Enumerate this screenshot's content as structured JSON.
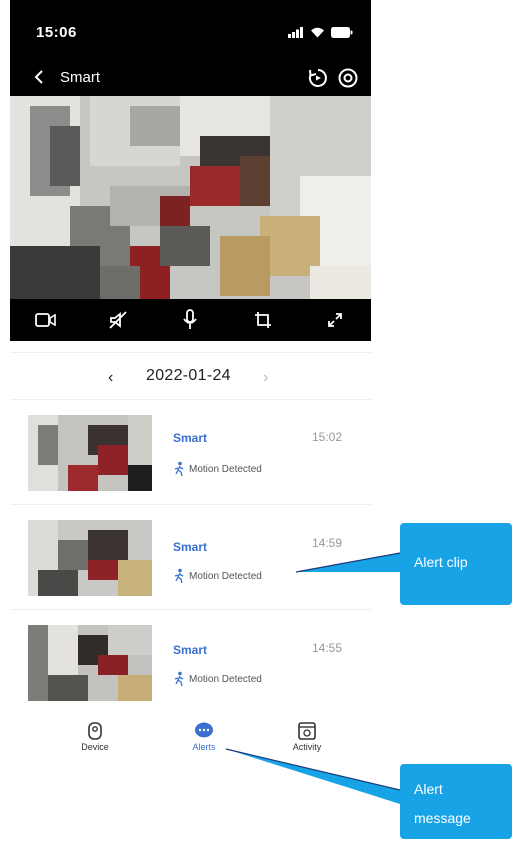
{
  "status": {
    "time": "15:06"
  },
  "header": {
    "title": "Smart"
  },
  "date_selector": {
    "date": "2022-01-24",
    "prev_symbol": "‹",
    "next_symbol": "›"
  },
  "alerts": [
    {
      "title": "Smart",
      "time": "15:02",
      "event": "Motion Detected"
    },
    {
      "title": "Smart",
      "time": "14:59",
      "event": "Motion Detected"
    },
    {
      "title": "Smart",
      "time": "14:55",
      "event": "Motion Detected"
    }
  ],
  "bottom_nav": {
    "items": [
      {
        "label": "Device",
        "icon": "device-icon",
        "active": false
      },
      {
        "label": "Alerts",
        "icon": "alerts-icon",
        "active": true
      },
      {
        "label": "Activity",
        "icon": "activity-icon",
        "active": false
      }
    ]
  },
  "callouts": {
    "alert_clip": "Alert clip",
    "alert_message_line1": "Alert",
    "alert_message_line2": "message"
  },
  "colors": {
    "accent": "#3b6fcf",
    "callout": "#18a3e6",
    "header_bg": "#000000"
  }
}
